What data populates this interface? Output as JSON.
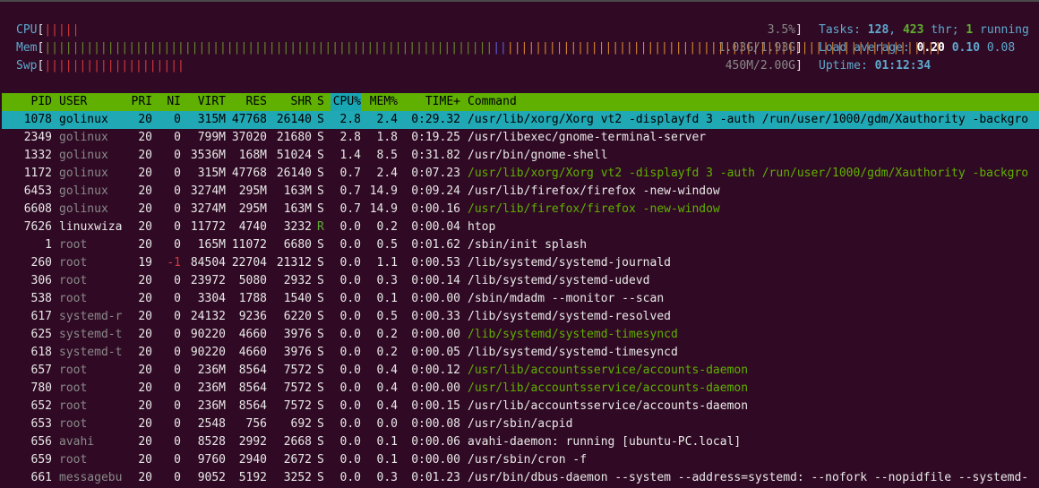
{
  "meters": {
    "cpu": {
      "label": "CPU",
      "bars": "|||||",
      "value": "3.5%"
    },
    "mem": {
      "label": "Mem",
      "bars_green": "||||||||||||||||||||||||||||||||||||||||||||||||||||||||||||||||",
      "bars_blue": "||",
      "bars_orange": "||||||||||||||||||||||||||||||||||||||||||||||||||||||||||||||",
      "value": "1.03G/1.93G"
    },
    "swp": {
      "label": "Swp",
      "bars": "||||||||||||||||||||",
      "value": "450M/2.00G"
    }
  },
  "stats": {
    "tasks_label": "Tasks: ",
    "tasks": "128",
    "sep": ", ",
    "threads": "423",
    "thr_label": " thr; ",
    "running": "1",
    "running_label": " running",
    "load_label": "Load average: ",
    "load1": "0.20",
    "load5": "0.10",
    "load15": "0.08",
    "uptime_label": "Uptime: ",
    "uptime": "01:12:34"
  },
  "columns": {
    "pid": "PID",
    "user": "USER",
    "pri": "PRI",
    "ni": "NI",
    "virt": "VIRT",
    "res": "RES",
    "shr": "SHR",
    "s": "S",
    "cpu": "CPU%",
    "mem": "MEM%",
    "time": "TIME+",
    "command": "Command"
  },
  "processes": [
    {
      "pid": "1078",
      "user": "golinux",
      "pri": "20",
      "ni": "0",
      "virt": "315M",
      "res": "47768",
      "shr": "26140",
      "s": "S",
      "cpu": "2.8",
      "mem": "2.4",
      "time": "0:29.32",
      "command": "/usr/lib/xorg/Xorg vt2 -displayfd 3 -auth /run/user/1000/gdm/Xauthority -backgro"
    },
    {
      "pid": "2349",
      "user": "golinux",
      "pri": "20",
      "ni": "0",
      "virt": "799M",
      "res": "37020",
      "shr": "21680",
      "s": "S",
      "cpu": "2.8",
      "mem": "1.8",
      "time": "0:19.25",
      "command": "/usr/libexec/gnome-terminal-server"
    },
    {
      "pid": "1332",
      "user": "golinux",
      "pri": "20",
      "ni": "0",
      "virt": "3536M",
      "res": "168M",
      "shr": "51024",
      "s": "S",
      "cpu": "1.4",
      "mem": "8.5",
      "time": "0:31.82",
      "command": "/usr/bin/gnome-shell"
    },
    {
      "pid": "1172",
      "user": "golinux",
      "pri": "20",
      "ni": "0",
      "virt": "315M",
      "res": "47768",
      "shr": "26140",
      "s": "S",
      "cpu": "0.7",
      "mem": "2.4",
      "time": "0:07.23",
      "command": "/usr/lib/xorg/Xorg vt2 -displayfd 3 -auth /run/user/1000/gdm/Xauthority -backgro"
    },
    {
      "pid": "6453",
      "user": "golinux",
      "pri": "20",
      "ni": "0",
      "virt": "3274M",
      "res": "295M",
      "shr": "163M",
      "s": "S",
      "cpu": "0.7",
      "mem": "14.9",
      "time": "0:09.24",
      "command": "/usr/lib/firefox/firefox -new-window"
    },
    {
      "pid": "6608",
      "user": "golinux",
      "pri": "20",
      "ni": "0",
      "virt": "3274M",
      "res": "295M",
      "shr": "163M",
      "s": "S",
      "cpu": "0.7",
      "mem": "14.9",
      "time": "0:00.16",
      "command": "/usr/lib/firefox/firefox -new-window"
    },
    {
      "pid": "7626",
      "user": "linuxwiza",
      "pri": "20",
      "ni": "0",
      "virt": "11772",
      "res": "4740",
      "shr": "3232",
      "s": "R",
      "cpu": "0.0",
      "mem": "0.2",
      "time": "0:00.04",
      "command": "htop"
    },
    {
      "pid": "1",
      "user": "root",
      "pri": "20",
      "ni": "0",
      "virt": "165M",
      "res": "11072",
      "shr": "6680",
      "s": "S",
      "cpu": "0.0",
      "mem": "0.5",
      "time": "0:01.62",
      "command": "/sbin/init splash"
    },
    {
      "pid": "260",
      "user": "root",
      "pri": "19",
      "ni": "-1",
      "virt": "84504",
      "res": "22704",
      "shr": "21312",
      "s": "S",
      "cpu": "0.0",
      "mem": "1.1",
      "time": "0:00.53",
      "command": "/lib/systemd/systemd-journald"
    },
    {
      "pid": "306",
      "user": "root",
      "pri": "20",
      "ni": "0",
      "virt": "23972",
      "res": "5080",
      "shr": "2932",
      "s": "S",
      "cpu": "0.0",
      "mem": "0.3",
      "time": "0:00.14",
      "command": "/lib/systemd/systemd-udevd"
    },
    {
      "pid": "538",
      "user": "root",
      "pri": "20",
      "ni": "0",
      "virt": "3304",
      "res": "1788",
      "shr": "1540",
      "s": "S",
      "cpu": "0.0",
      "mem": "0.1",
      "time": "0:00.00",
      "command": "/sbin/mdadm --monitor --scan"
    },
    {
      "pid": "617",
      "user": "systemd-r",
      "pri": "20",
      "ni": "0",
      "virt": "24132",
      "res": "9236",
      "shr": "6220",
      "s": "S",
      "cpu": "0.0",
      "mem": "0.5",
      "time": "0:00.33",
      "command": "/lib/systemd/systemd-resolved"
    },
    {
      "pid": "625",
      "user": "systemd-t",
      "pri": "20",
      "ni": "0",
      "virt": "90220",
      "res": "4660",
      "shr": "3976",
      "s": "S",
      "cpu": "0.0",
      "mem": "0.2",
      "time": "0:00.00",
      "command": "/lib/systemd/systemd-timesyncd"
    },
    {
      "pid": "618",
      "user": "systemd-t",
      "pri": "20",
      "ni": "0",
      "virt": "90220",
      "res": "4660",
      "shr": "3976",
      "s": "S",
      "cpu": "0.0",
      "mem": "0.2",
      "time": "0:00.05",
      "command": "/lib/systemd/systemd-timesyncd"
    },
    {
      "pid": "657",
      "user": "root",
      "pri": "20",
      "ni": "0",
      "virt": "236M",
      "res": "8564",
      "shr": "7572",
      "s": "S",
      "cpu": "0.0",
      "mem": "0.4",
      "time": "0:00.12",
      "command": "/usr/lib/accountsservice/accounts-daemon"
    },
    {
      "pid": "780",
      "user": "root",
      "pri": "20",
      "ni": "0",
      "virt": "236M",
      "res": "8564",
      "shr": "7572",
      "s": "S",
      "cpu": "0.0",
      "mem": "0.4",
      "time": "0:00.00",
      "command": "/usr/lib/accountsservice/accounts-daemon"
    },
    {
      "pid": "652",
      "user": "root",
      "pri": "20",
      "ni": "0",
      "virt": "236M",
      "res": "8564",
      "shr": "7572",
      "s": "S",
      "cpu": "0.0",
      "mem": "0.4",
      "time": "0:00.15",
      "command": "/usr/lib/accountsservice/accounts-daemon"
    },
    {
      "pid": "653",
      "user": "root",
      "pri": "20",
      "ni": "0",
      "virt": "2548",
      "res": "756",
      "shr": "692",
      "s": "S",
      "cpu": "0.0",
      "mem": "0.0",
      "time": "0:00.08",
      "command": "/usr/sbin/acpid"
    },
    {
      "pid": "656",
      "user": "avahi",
      "pri": "20",
      "ni": "0",
      "virt": "8528",
      "res": "2992",
      "shr": "2668",
      "s": "S",
      "cpu": "0.0",
      "mem": "0.1",
      "time": "0:00.06",
      "command": "avahi-daemon: running [ubuntu-PC.local]"
    },
    {
      "pid": "659",
      "user": "root",
      "pri": "20",
      "ni": "0",
      "virt": "9760",
      "res": "2940",
      "shr": "2672",
      "s": "S",
      "cpu": "0.0",
      "mem": "0.1",
      "time": "0:00.00",
      "command": "/usr/sbin/cron -f"
    },
    {
      "pid": "661",
      "user": "messagebu",
      "pri": "20",
      "ni": "0",
      "virt": "9052",
      "res": "5192",
      "shr": "3252",
      "s": "S",
      "cpu": "0.0",
      "mem": "0.3",
      "time": "0:01.23",
      "command": "/usr/bin/dbus-daemon --system --address=systemd: --nofork --nopidfile --systemd-"
    }
  ],
  "colors": {
    "background": "#300a24",
    "header": "#5fb000",
    "selected": "#20a8b4",
    "meter_label": "#5fa9cf",
    "thread": "#5fb000"
  }
}
